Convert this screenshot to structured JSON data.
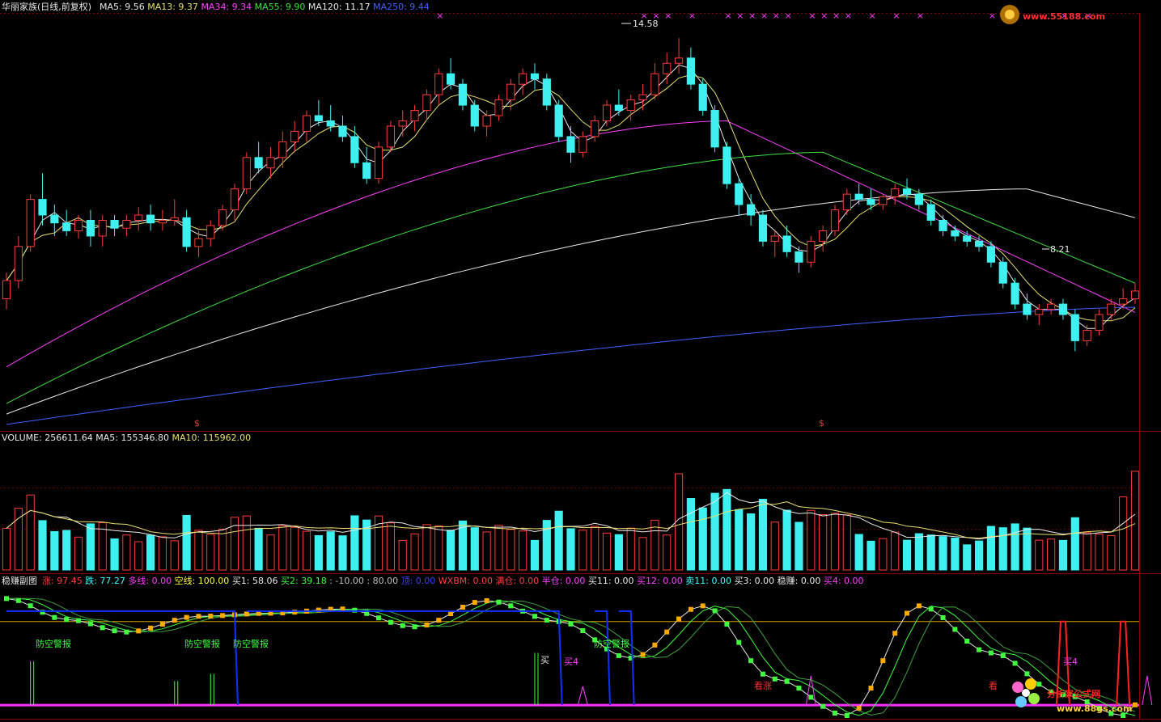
{
  "watermarks": {
    "top_right": "www.55188.com",
    "bottom_right_cn": "分析家公式网",
    "bottom_right_url": "www.88gs.com"
  },
  "price_panel": {
    "title": "华丽家族(日线,前复权)",
    "ma_labels": [
      {
        "text": "MA5: 9.56",
        "color": "#e8e8e8"
      },
      {
        "text": "MA13: 9.37",
        "color": "#e8e070"
      },
      {
        "text": "MA34: 9.34",
        "color": "#ff40ff"
      },
      {
        "text": "MA55: 9.90",
        "color": "#40e040"
      },
      {
        "text": "MA120: 11.17",
        "color": "#e8e8e8"
      },
      {
        "text": "MA250: 9.44",
        "color": "#4060ff"
      }
    ],
    "high_label": "14.58",
    "low_label": "8.21",
    "dollar_marker": "$"
  },
  "volume_panel": {
    "labels": [
      {
        "text": "VOLUME: 256611.64",
        "color": "#e8e8e8"
      },
      {
        "text": "MA5: 155346.80",
        "color": "#e8e8e8"
      },
      {
        "text": "MA10: 115962.00",
        "color": "#e8e070"
      }
    ]
  },
  "indicator_panel": {
    "title": "稳赚副图",
    "labels": [
      {
        "text": "涨: 97.45",
        "color": "#ff4040"
      },
      {
        "text": "跌: 77.27",
        "color": "#40ffff"
      },
      {
        "text": "多线: 0.00",
        "color": "#ff40ff"
      },
      {
        "text": "空线: 100.00",
        "color": "#ffff40"
      },
      {
        "text": "买1: 58.06",
        "color": "#e8e8e8"
      },
      {
        "text": "买2: 39.18",
        "color": "#40ff40"
      },
      {
        "text": ": -10.00",
        "color": "#c0c0c0"
      },
      {
        "text": ": 80.00",
        "color": "#c0c0c0"
      },
      {
        "text": "顶: 0.00",
        "color": "#4040ff"
      },
      {
        "text": "WXBM: 0.00",
        "color": "#ff4040"
      },
      {
        "text": "满仓: 0.00",
        "color": "#ff4040"
      },
      {
        "text": "半仓: 0.00",
        "color": "#ff40ff"
      },
      {
        "text": "买11: 0.00",
        "color": "#e8e8e8"
      },
      {
        "text": "买12: 0.00",
        "color": "#ff40ff"
      },
      {
        "text": "卖11: 0.00",
        "color": "#40ffff"
      },
      {
        "text": "买3: 0.00",
        "color": "#e8e8e8"
      },
      {
        "text": "稳赚: 0.00",
        "color": "#e8e8e8"
      },
      {
        "text": "买4: 0.00",
        "color": "#ff40ff"
      }
    ],
    "warning_label": "防空警报",
    "buy_label": "买",
    "buy4_label": "买4",
    "look_label": "看",
    "rise_label": "看涨"
  },
  "chart_data": {
    "type": "candlestick",
    "symbol": "华丽家族",
    "period": "日线",
    "adjustment": "前复权",
    "y_range": [
      7.2,
      15.0
    ],
    "high": 14.58,
    "low": 8.21,
    "candles": [
      [
        9.6,
        10.1,
        9.4,
        9.95
      ],
      [
        9.95,
        10.8,
        9.8,
        10.6
      ],
      [
        10.6,
        11.6,
        10.5,
        11.5
      ],
      [
        11.5,
        12.0,
        11.0,
        11.2
      ],
      [
        11.2,
        11.4,
        10.8,
        11.05
      ],
      [
        11.05,
        11.3,
        10.8,
        10.9
      ],
      [
        10.9,
        11.2,
        10.75,
        11.1
      ],
      [
        11.1,
        11.3,
        10.6,
        10.8
      ],
      [
        10.8,
        11.2,
        10.6,
        11.1
      ],
      [
        11.1,
        11.2,
        10.8,
        10.95
      ],
      [
        10.95,
        11.2,
        10.8,
        11.1
      ],
      [
        11.1,
        11.35,
        10.9,
        11.2
      ],
      [
        11.2,
        11.4,
        10.9,
        11.05
      ],
      [
        11.05,
        11.3,
        10.9,
        11.1
      ],
      [
        11.1,
        11.5,
        11.0,
        11.15
      ],
      [
        11.15,
        11.3,
        10.5,
        10.6
      ],
      [
        10.6,
        10.9,
        10.4,
        10.75
      ],
      [
        10.75,
        11.1,
        10.6,
        11.0
      ],
      [
        11.0,
        11.4,
        10.9,
        11.3
      ],
      [
        11.3,
        11.8,
        11.1,
        11.7
      ],
      [
        11.7,
        12.4,
        11.6,
        12.3
      ],
      [
        12.3,
        12.6,
        12.0,
        12.1
      ],
      [
        12.1,
        12.5,
        11.9,
        12.3
      ],
      [
        12.3,
        12.8,
        12.1,
        12.6
      ],
      [
        12.6,
        13.0,
        12.4,
        12.8
      ],
      [
        12.8,
        13.2,
        12.6,
        13.1
      ],
      [
        13.1,
        13.4,
        12.9,
        13.0
      ],
      [
        13.0,
        13.3,
        12.8,
        12.9
      ],
      [
        12.9,
        13.1,
        12.6,
        12.7
      ],
      [
        12.7,
        12.9,
        12.1,
        12.2
      ],
      [
        12.2,
        12.5,
        11.8,
        11.9
      ],
      [
        11.9,
        12.6,
        11.8,
        12.5
      ],
      [
        12.5,
        13.0,
        12.4,
        12.9
      ],
      [
        12.9,
        13.2,
        12.7,
        13.0
      ],
      [
        13.0,
        13.3,
        12.8,
        13.2
      ],
      [
        13.2,
        13.6,
        13.0,
        13.5
      ],
      [
        13.5,
        14.0,
        13.3,
        13.9
      ],
      [
        13.9,
        14.2,
        13.6,
        13.7
      ],
      [
        13.7,
        13.8,
        13.2,
        13.3
      ],
      [
        13.3,
        13.4,
        12.8,
        12.9
      ],
      [
        12.9,
        13.2,
        12.7,
        13.1
      ],
      [
        13.1,
        13.5,
        13.0,
        13.4
      ],
      [
        13.4,
        13.8,
        13.2,
        13.7
      ],
      [
        13.7,
        14.0,
        13.5,
        13.9
      ],
      [
        13.9,
        14.1,
        13.6,
        13.8
      ],
      [
        13.8,
        13.9,
        13.2,
        13.3
      ],
      [
        13.3,
        13.4,
        12.6,
        12.7
      ],
      [
        12.7,
        12.9,
        12.2,
        12.4
      ],
      [
        12.4,
        12.8,
        12.3,
        12.7
      ],
      [
        12.7,
        13.1,
        12.6,
        13.0
      ],
      [
        13.0,
        13.4,
        12.9,
        13.3
      ],
      [
        13.3,
        13.6,
        13.1,
        13.2
      ],
      [
        13.2,
        13.5,
        13.0,
        13.4
      ],
      [
        13.4,
        13.7,
        13.2,
        13.5
      ],
      [
        13.5,
        14.1,
        13.4,
        13.9
      ],
      [
        13.9,
        14.3,
        13.7,
        14.1
      ],
      [
        14.1,
        14.58,
        13.9,
        14.2
      ],
      [
        14.2,
        14.4,
        13.6,
        13.7
      ],
      [
        13.7,
        13.8,
        13.1,
        13.2
      ],
      [
        13.2,
        13.3,
        12.4,
        12.5
      ],
      [
        12.5,
        12.6,
        11.7,
        11.8
      ],
      [
        11.8,
        11.9,
        11.2,
        11.4
      ],
      [
        11.4,
        11.6,
        11.0,
        11.2
      ],
      [
        11.2,
        11.3,
        10.6,
        10.7
      ],
      [
        10.7,
        10.9,
        10.4,
        10.8
      ],
      [
        10.8,
        11.0,
        10.4,
        10.5
      ],
      [
        10.5,
        10.6,
        10.1,
        10.3
      ],
      [
        10.3,
        10.8,
        10.2,
        10.7
      ],
      [
        10.7,
        11.0,
        10.5,
        10.9
      ],
      [
        10.9,
        11.4,
        10.8,
        11.3
      ],
      [
        11.3,
        11.7,
        11.2,
        11.6
      ],
      [
        11.6,
        11.8,
        11.4,
        11.5
      ],
      [
        11.5,
        11.7,
        11.3,
        11.4
      ],
      [
        11.4,
        11.6,
        11.3,
        11.55
      ],
      [
        11.55,
        11.8,
        11.4,
        11.7
      ],
      [
        11.7,
        11.9,
        11.5,
        11.6
      ],
      [
        11.6,
        11.7,
        11.3,
        11.4
      ],
      [
        11.4,
        11.5,
        11.0,
        11.1
      ],
      [
        11.1,
        11.2,
        10.8,
        10.9
      ],
      [
        10.9,
        11.0,
        10.7,
        10.8
      ],
      [
        10.8,
        10.9,
        10.6,
        10.7
      ],
      [
        10.7,
        10.8,
        10.5,
        10.6
      ],
      [
        10.6,
        10.7,
        10.2,
        10.3
      ],
      [
        10.3,
        10.4,
        9.8,
        9.9
      ],
      [
        9.9,
        10.0,
        9.4,
        9.5
      ],
      [
        9.5,
        9.7,
        9.2,
        9.3
      ],
      [
        9.3,
        9.5,
        9.1,
        9.4
      ],
      [
        9.4,
        9.6,
        9.3,
        9.5
      ],
      [
        9.5,
        9.6,
        9.2,
        9.3
      ],
      [
        9.3,
        9.4,
        8.6,
        8.8
      ],
      [
        8.8,
        9.1,
        8.7,
        9.0
      ],
      [
        9.0,
        9.4,
        8.9,
        9.3
      ],
      [
        9.3,
        9.6,
        9.2,
        9.5
      ],
      [
        9.5,
        9.8,
        9.4,
        9.6
      ],
      [
        9.6,
        9.9,
        9.5,
        9.75
      ]
    ],
    "volume": {
      "labels": [
        "VOLUME",
        "MA5",
        "MA10"
      ],
      "values": [
        256611.64,
        155346.8,
        115962.0
      ],
      "y_max": 330000
    },
    "indicator": {
      "name": "稳赚副图",
      "y_range": [
        -10,
        110
      ],
      "reference_lines": [
        80,
        -10
      ]
    }
  }
}
